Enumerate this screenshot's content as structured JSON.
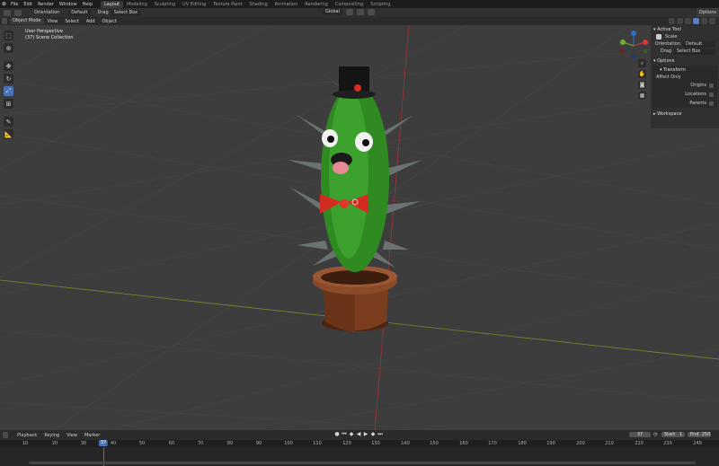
{
  "topbar": {
    "menu": [
      "File",
      "Edit",
      "Render",
      "Window",
      "Help"
    ],
    "workspaces": [
      "Layout",
      "Modeling",
      "Sculpting",
      "UV Editing",
      "Texture Paint",
      "Shading",
      "Animation",
      "Rendering",
      "Compositing",
      "Scripting"
    ],
    "active_workspace": "Layout"
  },
  "toolbar": {
    "orientation_label": "Orientation",
    "orientation_value": "Default",
    "drag_label": "Drag",
    "drag_value": "Select Box",
    "transform_orientation": "Global",
    "options_label": "Options"
  },
  "header": {
    "mode": "Object Mode",
    "menu": [
      "View",
      "Select",
      "Add",
      "Object"
    ]
  },
  "viewport": {
    "perspective_label": "User Perspective",
    "collection_label": "(37) Scene Collection"
  },
  "left_tools": [
    "select-box",
    "cursor",
    "move",
    "rotate",
    "scale",
    "transform",
    "annotate",
    "measure"
  ],
  "sidepanel": {
    "active_tool_title": "Active Tool",
    "tool_name": "Scale",
    "orientation_label": "Orientation",
    "orientation_value": "Default",
    "drag_label": "Drag",
    "drag_value": "Select Box",
    "options_title": "Options",
    "transform_title": "Transform",
    "affect_only": "Affect Only",
    "checks": [
      "Origins",
      "Locations",
      "Parents"
    ],
    "workspace_title": "Workspace"
  },
  "timeline": {
    "menu": [
      "Playback",
      "Keying",
      "View",
      "Marker"
    ],
    "current_frame": "37",
    "start_label": "Start",
    "start_value": "1",
    "end_label": "End",
    "end_value": "250",
    "ticks": [
      "10",
      "20",
      "30",
      "40",
      "50",
      "60",
      "70",
      "80",
      "90",
      "100",
      "110",
      "120",
      "130",
      "140",
      "150",
      "160",
      "170",
      "180",
      "190",
      "200",
      "210",
      "220",
      "230",
      "240"
    ]
  },
  "colors": {
    "accent": "#4772b3",
    "viewport_bg": "#3d3d3d",
    "cactus": "#3a9a2a",
    "pot": "#7a3e1e",
    "bowtie": "#d42c22"
  }
}
